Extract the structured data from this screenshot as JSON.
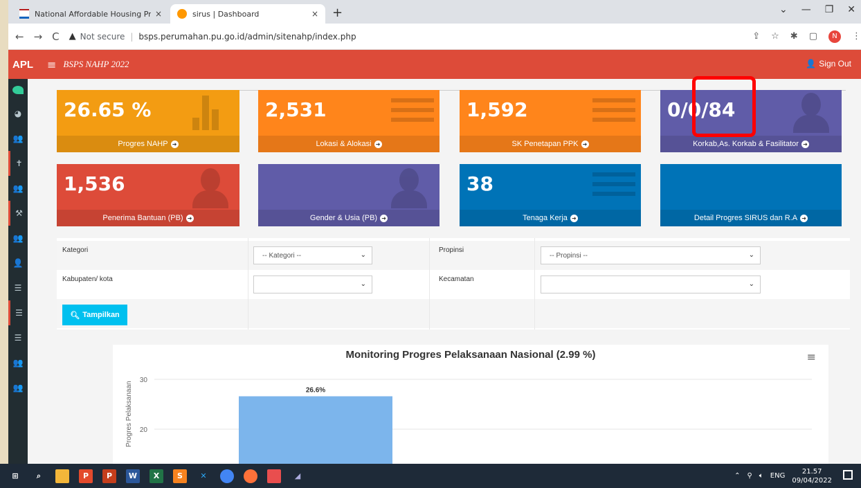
{
  "browser": {
    "tabs": [
      {
        "title": "National Affordable Housing Pro"
      },
      {
        "title": "sirus | Dashboard"
      }
    ],
    "new_tab": "+",
    "close": "×",
    "window_controls": [
      "⌄",
      "—",
      "❐",
      "✕"
    ],
    "back": "←",
    "forward": "→",
    "reload": "C",
    "security_text": "Not secure",
    "url": "bsps.perumahan.pu.go.id/admin/sitenahp/index.php",
    "profile_initial": "N"
  },
  "app": {
    "logo": "APL",
    "title": "BSPS NAHP 2022",
    "sign_out": "Sign Out",
    "brand_color": "#dd4b39"
  },
  "sidebar": {
    "icons": [
      "leaf-icon",
      "dashboard-icon",
      "users-icon",
      "pin-icon",
      "users-icon",
      "hammer-icon",
      "users-icon",
      "user-icon",
      "list-icon",
      "list-icon",
      "list-icon",
      "users-icon",
      "users-icon"
    ]
  },
  "boxes": [
    {
      "value": "26.65 %",
      "label": "Progres NAHP",
      "color": "#f39c12"
    },
    {
      "value": "2,531",
      "label": "Lokasi & Alokasi",
      "color": "#ff851b"
    },
    {
      "value": "1,592",
      "label": "SK Penetapan PPK",
      "color": "#ff851b"
    },
    {
      "value": "0/0/84",
      "label": "Korkab,As. Korkab & Fasilitator",
      "color": "#605ca8"
    },
    {
      "value": "1,536",
      "label": "Penerima Bantuan (PB)",
      "color": "#dd4b39"
    },
    {
      "value": "",
      "label": "Gender & Usia (PB)",
      "color": "#605ca8"
    },
    {
      "value": "38",
      "label": "Tenaga Kerja",
      "color": "#0073b7"
    },
    {
      "value": "",
      "label": "Detail Progres SIRUS dan R.A",
      "color": "#0073b7"
    }
  ],
  "filters": {
    "kategori_label": "Kategori",
    "kategori_value": "-- Kategori --",
    "propinsi_label": "Propinsi",
    "propinsi_value": "-- Propinsi --",
    "kabupaten_label": "Kabupaten/ kota",
    "kabupaten_value": "",
    "kecamatan_label": "Kecamatan",
    "kecamatan_value": "",
    "show_button": "Tampilkan"
  },
  "chart_data": {
    "type": "bar",
    "title": "Monitoring Progres Pelaksanaan Nasional (2.99 %)",
    "ylabel": "Progres Pelaksanaan",
    "xlabel": "",
    "categories": [
      ""
    ],
    "values": [
      26.6
    ],
    "data_labels": [
      "26.6%"
    ],
    "y_ticks": [
      "30",
      "20"
    ],
    "ylim": [
      0,
      30
    ],
    "bar_color": "#7cb5ec",
    "grid": true
  },
  "taskbar": {
    "time": "21.57",
    "date": "09/04/2022",
    "lang": "ENG"
  }
}
